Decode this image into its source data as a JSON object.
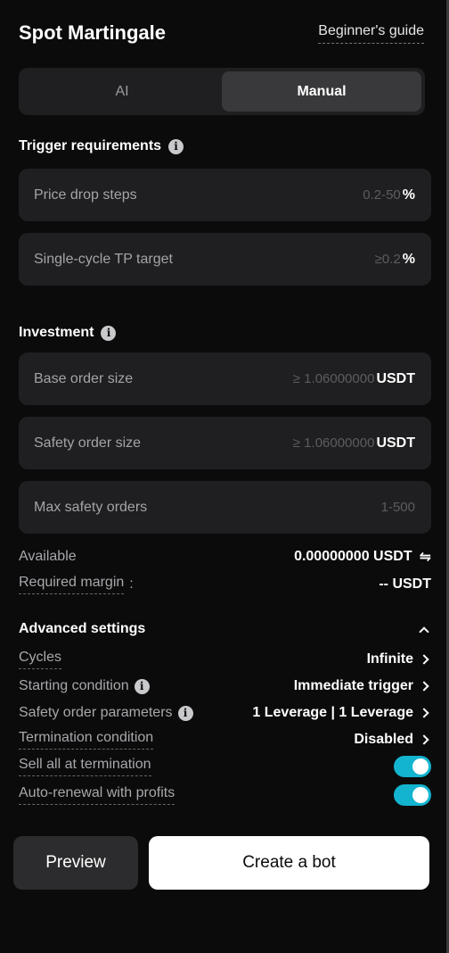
{
  "header": {
    "title": "Spot Martingale",
    "guide_link": "Beginner's guide"
  },
  "mode_tabs": [
    {
      "label": "AI",
      "active": false
    },
    {
      "label": "Manual",
      "active": true
    }
  ],
  "trigger": {
    "title": "Trigger requirements",
    "fields": [
      {
        "label": "Price drop steps",
        "placeholder": "0.2-50",
        "unit": "%"
      },
      {
        "label": "Single-cycle TP target",
        "placeholder": "≥0.2",
        "unit": "%"
      }
    ]
  },
  "investment": {
    "title": "Investment",
    "fields": [
      {
        "label": "Base order size",
        "placeholder": "≥ 1.06000000",
        "unit": "USDT"
      },
      {
        "label": "Safety order size",
        "placeholder": "≥ 1.06000000",
        "unit": "USDT"
      },
      {
        "label": "Max safety orders",
        "placeholder": "1-500",
        "unit": ""
      }
    ],
    "available_label": "Available",
    "available_value": "0.00000000 USDT",
    "margin_label": "Required margin",
    "margin_colon": ":",
    "margin_value": "-- USDT"
  },
  "advanced": {
    "title": "Advanced settings",
    "rows": [
      {
        "label": "Cycles",
        "value": "Infinite"
      },
      {
        "label": "Starting condition",
        "value": "Immediate trigger"
      },
      {
        "label": "Safety order parameters",
        "value": "1 Leverage | 1 Leverage"
      },
      {
        "label": "Termination condition",
        "value": "Disabled"
      },
      {
        "label": "Sell all at termination",
        "toggle": true
      },
      {
        "label": "Auto-renewal with profits",
        "toggle": true
      }
    ]
  },
  "actions": {
    "preview_label": "Preview",
    "create_label": "Create a bot"
  },
  "colors": {
    "background": "#0b0b0c",
    "field_bg": "#1f1f21",
    "toggle_on": "#13b4cf"
  },
  "icons": {
    "info": "info-icon",
    "swap": "swap-icon",
    "chevron": "chevron-right-icon",
    "collapse": "chevron-up-icon"
  }
}
